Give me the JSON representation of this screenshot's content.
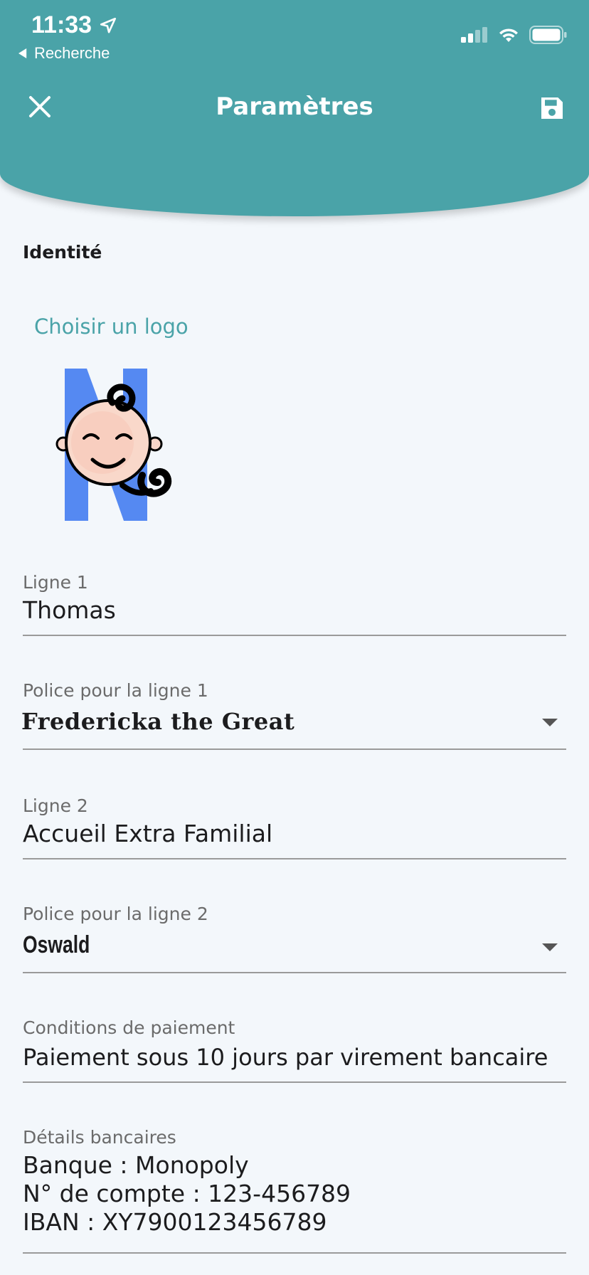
{
  "status_bar": {
    "time": "11:33",
    "back_label": "Recherche"
  },
  "header": {
    "title": "Paramètres",
    "close_icon": "close-icon",
    "save_icon": "save-icon",
    "background_color": "#4aa3a8"
  },
  "identity": {
    "section_title": "Identité",
    "choose_logo_label": "Choisir un logo",
    "logo_icon": "baby-face-logo"
  },
  "fields": {
    "line1": {
      "label": "Ligne 1",
      "value": "Thomas"
    },
    "font_line1": {
      "label": "Police pour la ligne 1",
      "value": "Fredericka the Great"
    },
    "line2": {
      "label": "Ligne 2",
      "value": "Accueil Extra Familial"
    },
    "font_line2": {
      "label": "Police pour la ligne 2",
      "value": "Oswald"
    },
    "payment_conditions": {
      "label": "Conditions de paiement",
      "value": "Paiement sous 10 jours par virement bancaire"
    },
    "bank_details": {
      "label": "Détails bancaires",
      "value": "Banque : Monopoly\nN° de compte : 123-456789\nIBAN : XY7900123456789"
    }
  },
  "colors": {
    "accent": "#4aa3a8",
    "logo_blue": "#5589f2"
  }
}
